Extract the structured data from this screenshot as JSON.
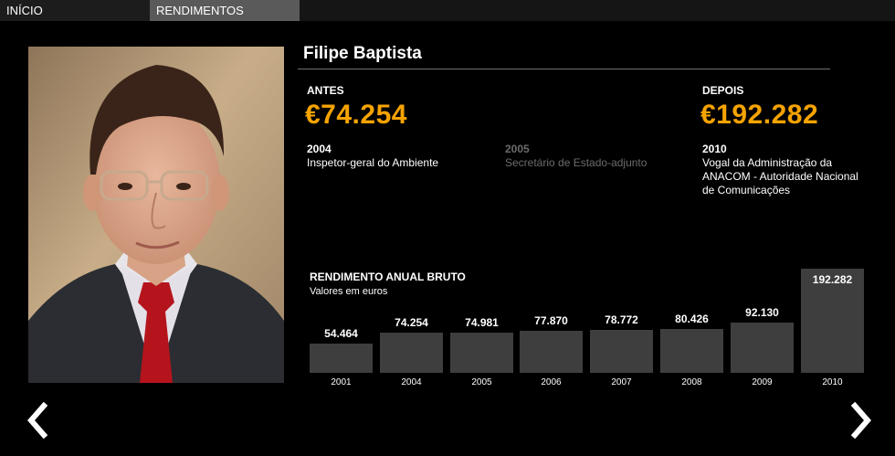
{
  "nav": {
    "tabs": [
      {
        "label": "INÍCIO",
        "active": false
      },
      {
        "label": "RENDIMENTOS",
        "active": true
      }
    ]
  },
  "profile": {
    "name": "Filipe Baptista"
  },
  "before": {
    "label": "ANTES",
    "amount": "€74.254",
    "year": "2004",
    "role": "Inspetor-geral do Ambiente"
  },
  "middle": {
    "year": "2005",
    "role": "Secretário de Estado-adjunto"
  },
  "after": {
    "label": "DEPOIS",
    "amount": "€192.282",
    "year": "2010",
    "role_lines": [
      "Vogal da Administração da",
      "ANACOM - Autoridade Nacional",
      "de Comunicações"
    ]
  },
  "colors": {
    "accent": "#f5a300",
    "bar": "#3e3e3e",
    "background": "#000000"
  },
  "icons": {
    "prev": "chevron-left-icon",
    "next": "chevron-right-icon"
  },
  "chart_data": {
    "type": "bar",
    "title": "RENDIMENTO ANUAL BRUTO",
    "subtitle": "Valores em euros",
    "categories": [
      "2001",
      "2004",
      "2005",
      "2006",
      "2007",
      "2008",
      "2009",
      "2010"
    ],
    "values": [
      54464,
      74254,
      74981,
      77870,
      78772,
      80426,
      92130,
      192282
    ],
    "value_labels": [
      "54.464",
      "74.254",
      "74.981",
      "77.870",
      "78.772",
      "80.426",
      "92.130",
      "192.282"
    ],
    "ylim": [
      0,
      192282
    ],
    "grid": false,
    "legend": "none"
  }
}
